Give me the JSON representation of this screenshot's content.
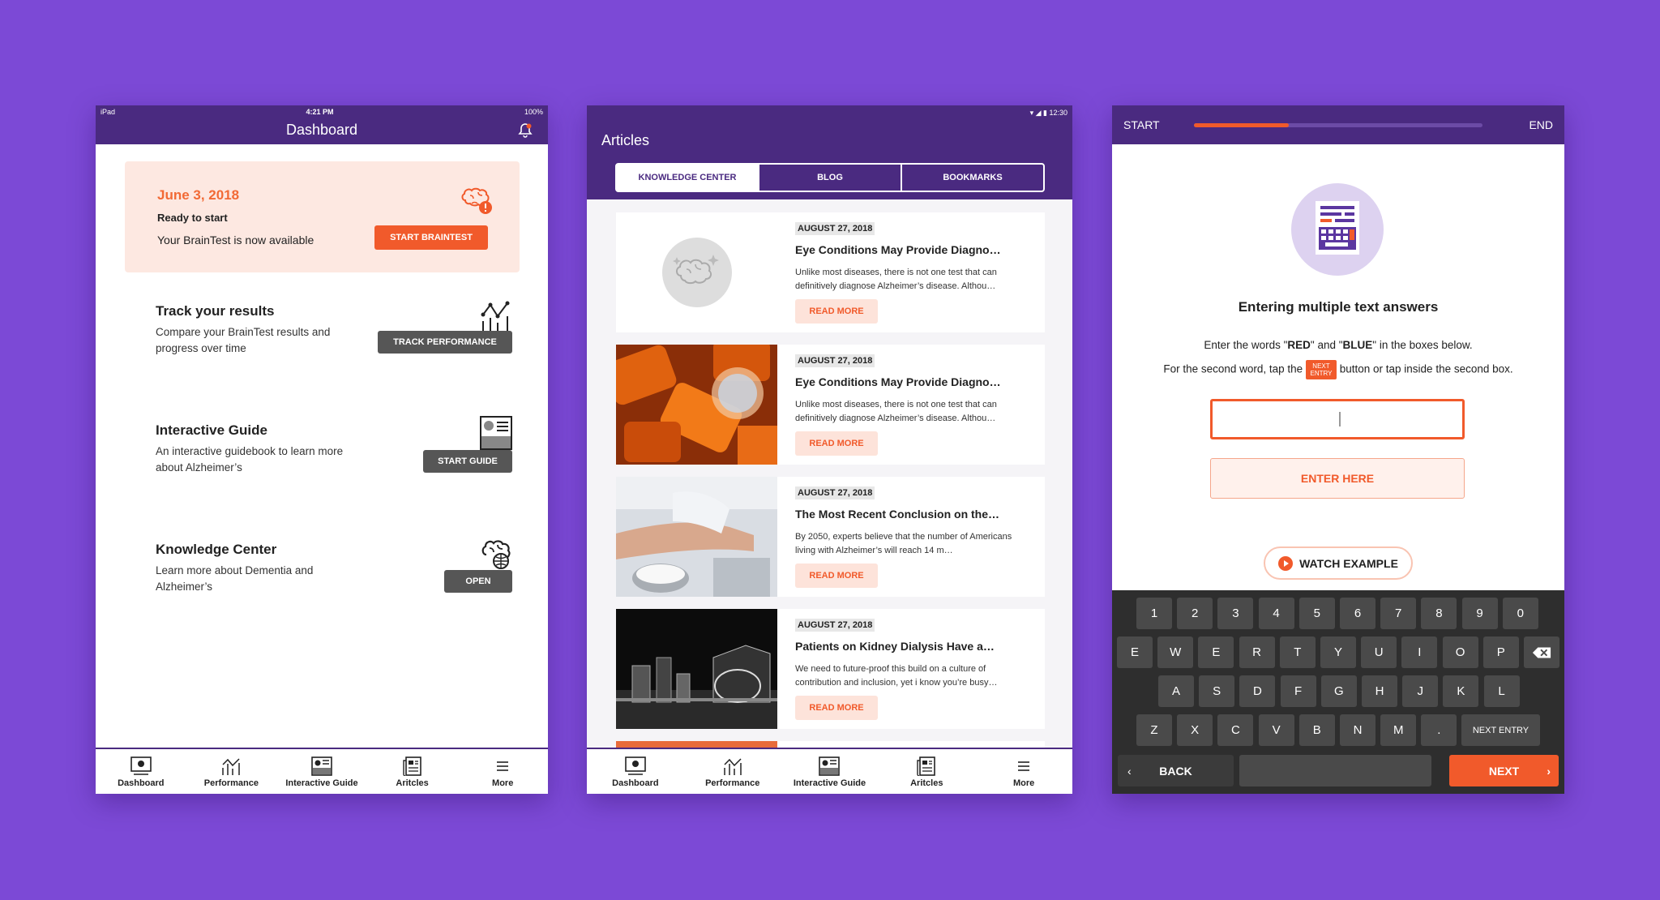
{
  "dashboard": {
    "status": {
      "left": "iPad",
      "time": "4:21 PM",
      "battery": "100%"
    },
    "title": "Dashboard",
    "start_card": {
      "date": "June 3, 2018",
      "ready": "Ready to start",
      "available": "Your BrainTest is now available",
      "button": "START BRAINTEST"
    },
    "track": {
      "heading": "Track your results",
      "desc": "Compare your BrainTest results and progress over time",
      "button": "TRACK PERFORMANCE"
    },
    "guide": {
      "heading": "Interactive Guide",
      "desc": "An interactive guidebook to learn more about Alzheimer’s",
      "button": "START GUIDE"
    },
    "knowledge": {
      "heading": "Knowledge Center",
      "desc": "Learn more about Dementia and Alzheimer’s",
      "button": "OPEN"
    }
  },
  "tabs": [
    {
      "label": "Dashboard",
      "icon": "dashboard-icon"
    },
    {
      "label": "Performance",
      "icon": "performance-icon"
    },
    {
      "label": "Interactive Guide",
      "icon": "guide-icon"
    },
    {
      "label": "Aritcles",
      "icon": "articles-icon"
    },
    {
      "label": "More",
      "icon": "menu-icon"
    }
  ],
  "articles": {
    "status_time": "12:30",
    "title": "Articles",
    "segments": [
      "KNOWLEDGE CENTER",
      "BLOG",
      "BOOKMARKS"
    ],
    "read_more": "READ MORE",
    "items": [
      {
        "date": "AUGUST 27, 2018",
        "title": "Eye Conditions May Provide Diagno…",
        "excerpt": "Unlike most diseases, there is not one test that can definitively diagnose Alzheimer’s disease. Althou…"
      },
      {
        "date": "AUGUST 27, 2018",
        "title": "Eye Conditions May Provide Diagno…",
        "excerpt": "Unlike most diseases, there is not one test that can definitively diagnose Alzheimer’s disease. Althou…"
      },
      {
        "date": "AUGUST 27, 2018",
        "title": "The Most Recent Conclusion on the…",
        "excerpt": "By 2050, experts believe that the number of Americans living with Alzheimer’s will reach 14 m…"
      },
      {
        "date": "AUGUST 27, 2018",
        "title": "Patients on Kidney Dialysis Have a…",
        "excerpt": "We need to future-proof this build on a culture of contribution and inclusion, yet i know you’re busy…"
      }
    ]
  },
  "test": {
    "start": "START",
    "end": "END",
    "progress": 0.33,
    "heading": "Entering multiple text answers",
    "line1_a": "Enter the words \"",
    "red": "RED",
    "line1_b": "\" and \"",
    "blue": "BLUE",
    "line1_c": "\" in the boxes below.",
    "line2_a": "For the second word, tap the",
    "chip": "NEXT ENTRY",
    "line2_b": "button or tap inside the second box.",
    "enter_here": "ENTER HERE",
    "watch": "WATCH EXAMPLE",
    "keyboard": {
      "row1": [
        "1",
        "2",
        "3",
        "4",
        "5",
        "6",
        "7",
        "8",
        "9",
        "0"
      ],
      "row2": [
        "E",
        "W",
        "E",
        "R",
        "T",
        "Y",
        "U",
        "I",
        "O",
        "P"
      ],
      "row3": [
        "A",
        "S",
        "D",
        "F",
        "G",
        "H",
        "J",
        "K",
        "L"
      ],
      "row4": [
        "Z",
        "X",
        "C",
        "V",
        "B",
        "N",
        "M",
        "."
      ],
      "next_entry": "NEXT ENTRY",
      "back": "BACK",
      "next": "NEXT"
    }
  },
  "colors": {
    "purple": "#4a2a80",
    "background": "#7c49d6",
    "orange": "#f15a2b",
    "peach": "#fde8e1"
  }
}
